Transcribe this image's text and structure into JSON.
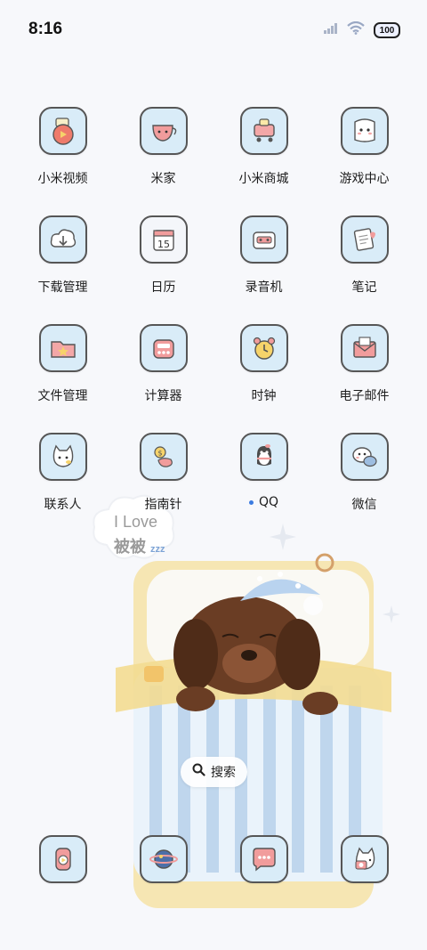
{
  "status_bar": {
    "time": "8:16",
    "battery": "100"
  },
  "apps": [
    {
      "label": "小米视频",
      "icon": "apple-video-icon"
    },
    {
      "label": "米家",
      "icon": "teacup-home-icon"
    },
    {
      "label": "小米商城",
      "icon": "shopping-cart-icon"
    },
    {
      "label": "游戏中心",
      "icon": "ghost-game-icon"
    },
    {
      "label": "下载管理",
      "icon": "download-cloud-icon"
    },
    {
      "label": "日历",
      "icon": "calendar-icon"
    },
    {
      "label": "录音机",
      "icon": "recorder-icon"
    },
    {
      "label": "笔记",
      "icon": "notes-icon"
    },
    {
      "label": "文件管理",
      "icon": "folder-icon"
    },
    {
      "label": "计算器",
      "icon": "calculator-icon"
    },
    {
      "label": "时钟",
      "icon": "alarm-clock-icon"
    },
    {
      "label": "电子邮件",
      "icon": "mail-icon"
    },
    {
      "label": "联系人",
      "icon": "contacts-cat-icon"
    },
    {
      "label": "指南针",
      "icon": "compass-icon"
    },
    {
      "label": "QQ",
      "icon": "qq-penguin-icon"
    },
    {
      "label": "微信",
      "icon": "wechat-icon"
    }
  ],
  "calendar_day": "15",
  "wallpaper": {
    "cloud_line1": "I Love",
    "cloud_line2": "被被",
    "zzz": "zzz"
  },
  "search": {
    "label": "搜索"
  },
  "dock": [
    {
      "icon": "video-player-icon"
    },
    {
      "icon": "browser-planet-icon"
    },
    {
      "icon": "messages-icon"
    },
    {
      "icon": "camera-icon"
    }
  ],
  "colors": {
    "tile_bg": "#d9ecf8",
    "tile_border": "#565656",
    "accent_red": "#e86a6a",
    "bed_yellow": "#f6e3a6"
  }
}
